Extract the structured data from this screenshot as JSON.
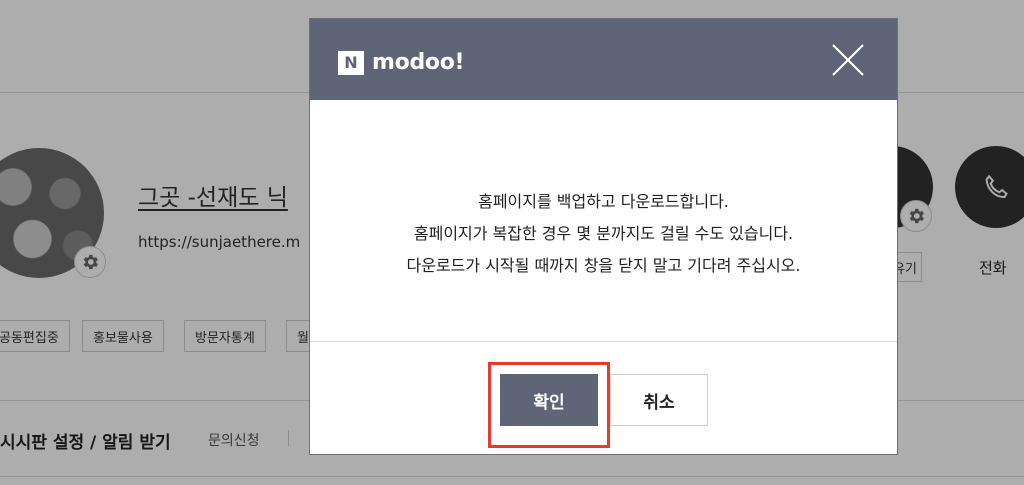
{
  "background": {
    "site_title": "그곳 -선재도 닉",
    "site_url": "https://sunjaethere.m",
    "chips": [
      "공동편집중",
      "홍보물사용",
      "방문자통계",
      "월"
    ],
    "board_label": "시시판 설정 / 알림 받기",
    "inquiry_link": "문의신청",
    "share_label": "유기",
    "call_label": "전화"
  },
  "modal": {
    "logo_mark": "N",
    "logo_text": "modoo!",
    "message_lines": [
      "홈페이지를 백업하고 다운로드합니다.",
      "홈페이지가 복잡한 경우 몇 분까지도 걸릴 수도 있습니다.",
      "다운로드가 시작될 때까지 창을 닫지 말고 기다려 주십시오."
    ],
    "confirm_label": "확인",
    "cancel_label": "취소"
  },
  "colors": {
    "header": "#5f6577",
    "highlight": "#e53c2e",
    "overlay": "rgba(0,0,0,0.32)"
  },
  "icons": [
    "gear-icon",
    "phone-icon",
    "close-icon"
  ]
}
